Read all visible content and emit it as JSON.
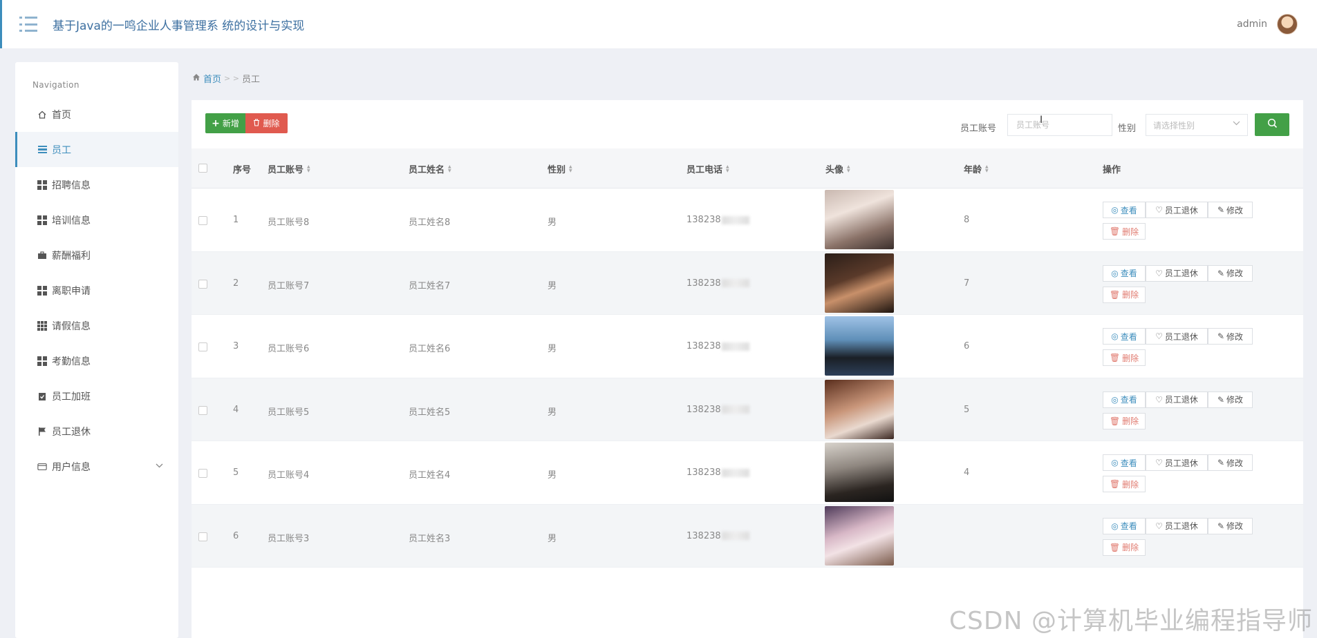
{
  "header": {
    "title": "基于Java的一鸣企业人事管理系 统的设计与实现",
    "username": "admin"
  },
  "sidebar": {
    "title": "Navigation",
    "items": [
      {
        "label": "首页",
        "icon": "home-icon"
      },
      {
        "label": "员工",
        "icon": "list-icon"
      },
      {
        "label": "招聘信息",
        "icon": "grid-icon"
      },
      {
        "label": "培训信息",
        "icon": "grid-icon"
      },
      {
        "label": "薪酬福利",
        "icon": "briefcase-icon"
      },
      {
        "label": "离职申请",
        "icon": "grid-icon"
      },
      {
        "label": "请假信息",
        "icon": "table-icon"
      },
      {
        "label": "考勤信息",
        "icon": "grid-icon"
      },
      {
        "label": "员工加班",
        "icon": "clipboard-icon"
      },
      {
        "label": "员工退休",
        "icon": "flag-icon"
      },
      {
        "label": "用户信息",
        "icon": "wallet-icon"
      }
    ]
  },
  "breadcrumb": {
    "home": "首页",
    "separator": "> >",
    "current": "员工"
  },
  "toolbar": {
    "add_label": "新增",
    "delete_label": "删除",
    "account_label": "员工账号",
    "account_placeholder": "员工账号",
    "gender_label": "性别",
    "gender_placeholder": "请选择性别"
  },
  "table": {
    "columns": [
      "序号",
      "员工账号",
      "员工姓名",
      "性别",
      "员工电话",
      "头像",
      "年龄",
      "操作"
    ],
    "actions": {
      "view": "查看",
      "retire": "员工退休",
      "edit": "修改",
      "delete": "删除"
    },
    "rows": [
      {
        "index": "1",
        "account": "员工账号8",
        "name": "员工姓名8",
        "gender": "男",
        "phone": "138238",
        "age": "8"
      },
      {
        "index": "2",
        "account": "员工账号7",
        "name": "员工姓名7",
        "gender": "男",
        "phone": "138238",
        "age": "7"
      },
      {
        "index": "3",
        "account": "员工账号6",
        "name": "员工姓名6",
        "gender": "男",
        "phone": "138238",
        "age": "6"
      },
      {
        "index": "4",
        "account": "员工账号5",
        "name": "员工姓名5",
        "gender": "男",
        "phone": "138238",
        "age": "5"
      },
      {
        "index": "5",
        "account": "员工账号4",
        "name": "员工姓名4",
        "gender": "男",
        "phone": "138238",
        "age": "4"
      },
      {
        "index": "6",
        "account": "员工账号3",
        "name": "员工姓名3",
        "gender": "男",
        "phone": "138238",
        "age": ""
      }
    ]
  },
  "watermark": "CSDN @计算机毕业编程指导师",
  "colors": {
    "primary": "#3c8dbc",
    "success": "#43a047",
    "danger": "#e05a4f"
  }
}
